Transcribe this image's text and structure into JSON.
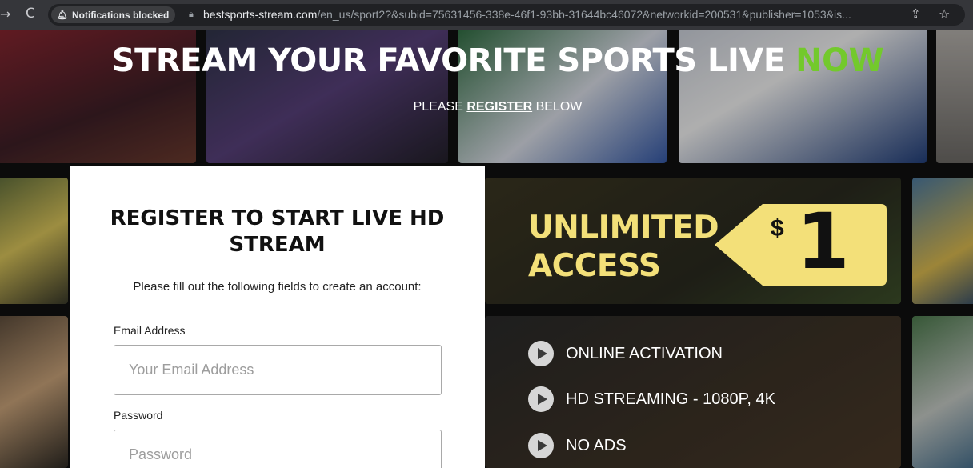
{
  "browser": {
    "notification_chip": "Notifications blocked",
    "url_host": "bestsports-stream.com",
    "url_path": "/en_us/sport2?&subid=75631456-338e-46f1-93bb-31644bc46072&networkid=200531&publisher=1053&is..."
  },
  "hero": {
    "headline_1": "STREAM YOUR FAVORITE ",
    "headline_2": "SPORTS LIVE ",
    "headline_3": "NOW",
    "sub_1": "PLEASE ",
    "sub_2": "REGISTER",
    "sub_3": " BELOW"
  },
  "form": {
    "title": "REGISTER TO START LIVE HD STREAM",
    "description": "Please fill out the following fields to create an account:",
    "email_label": "Email Address",
    "email_placeholder": "Your Email Address",
    "password_label": "Password",
    "password_placeholder": "Password"
  },
  "offer": {
    "line_1": "UNLIMITED",
    "line_2": "ACCESS",
    "currency": "$",
    "price": "1"
  },
  "features": [
    "ONLINE ACTIVATION",
    "HD STREAMING - 1080P, 4K",
    "NO ADS"
  ],
  "colors": {
    "accent_green": "#73c92c",
    "accent_yellow": "#f3e079"
  },
  "icons": [
    "arrow-back-icon",
    "reload-icon",
    "bell-icon",
    "lock-icon",
    "share-icon",
    "star-icon",
    "play-icon"
  ]
}
